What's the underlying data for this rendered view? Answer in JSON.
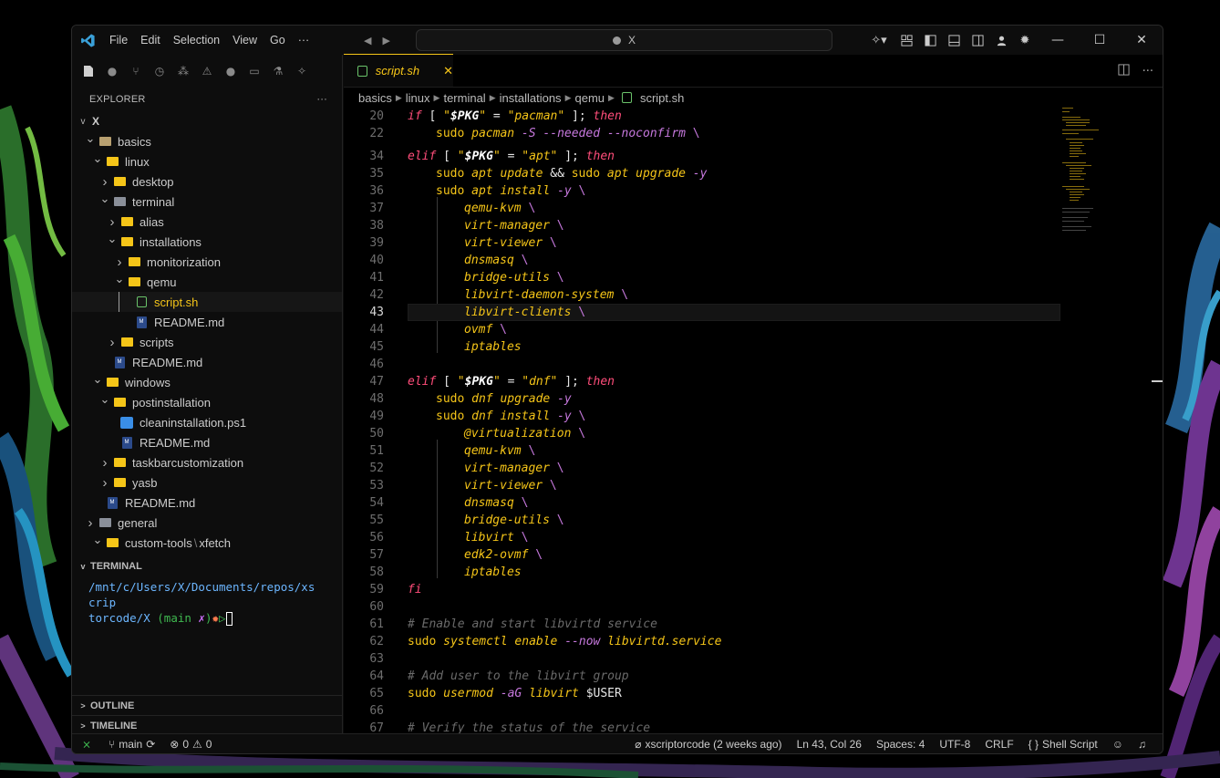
{
  "titlebar": {
    "menu": [
      "File",
      "Edit",
      "Selection",
      "View",
      "Go"
    ],
    "more": "···",
    "command_center": "X"
  },
  "explorer": {
    "header": "EXPLORER",
    "more": "···",
    "root": "X",
    "rows": [
      {
        "indent": 1,
        "chev": "v",
        "icon": "folder-dim",
        "label": "basics"
      },
      {
        "indent": 2,
        "chev": "v",
        "icon": "folder",
        "label": "linux"
      },
      {
        "indent": 3,
        "chev": ">",
        "icon": "folder",
        "label": "desktop"
      },
      {
        "indent": 3,
        "chev": "v",
        "icon": "folder-gray",
        "label": "terminal"
      },
      {
        "indent": 4,
        "chev": ">",
        "icon": "folder",
        "label": "alias"
      },
      {
        "indent": 4,
        "chev": "v",
        "icon": "folder",
        "label": "installations"
      },
      {
        "indent": 5,
        "chev": ">",
        "icon": "folder",
        "label": "monitorization"
      },
      {
        "indent": 5,
        "chev": "v",
        "icon": "folder",
        "label": "qemu"
      },
      {
        "indent": 6,
        "chev": "",
        "icon": "shell",
        "label": "script.sh",
        "active": true
      },
      {
        "indent": 6,
        "chev": "",
        "icon": "md",
        "label": "README.md"
      },
      {
        "indent": 4,
        "chev": ">",
        "icon": "folder",
        "label": "scripts"
      },
      {
        "indent": 4,
        "chev": "",
        "icon": "md",
        "label": "README.md",
        "shift": -1
      },
      {
        "indent": 2,
        "chev": "v",
        "icon": "folder",
        "label": "windows"
      },
      {
        "indent": 3,
        "chev": "v",
        "icon": "folder",
        "label": "postinstallation"
      },
      {
        "indent": 4,
        "chev": "",
        "icon": "ps",
        "label": "cleaninstallation.ps1"
      },
      {
        "indent": 4,
        "chev": "",
        "icon": "md",
        "label": "README.md"
      },
      {
        "indent": 3,
        "chev": ">",
        "icon": "folder",
        "label": "taskbarcustomization"
      },
      {
        "indent": 3,
        "chev": ">",
        "icon": "folder",
        "label": "yasb"
      },
      {
        "indent": 3,
        "chev": "",
        "icon": "md",
        "label": "README.md",
        "shift": -1
      },
      {
        "indent": 1,
        "chev": ">",
        "icon": "folder-gray",
        "label": "general"
      },
      {
        "indent": 2,
        "chev": "v",
        "icon": "folder",
        "label": "custom-tools",
        "suffix": "xfetch"
      }
    ]
  },
  "terminal": {
    "header": "TERMINAL",
    "path_line1": "/mnt/c/Users/X/Documents/repos/xscrip",
    "path_line2": "torcode/X",
    "branch_open": "(main ",
    "branch_mark": "✗",
    "branch_close": ")",
    "glyph1": "✹",
    "glyph2": "▷"
  },
  "panels": {
    "outline": "OUTLINE",
    "timeline": "TIMELINE"
  },
  "editor": {
    "tab_label": "script.sh",
    "tab_close": "✕",
    "breadcrumb": [
      "basics",
      "linux",
      "terminal",
      "installations",
      "qemu"
    ],
    "breadcrumb_file": "script.sh",
    "current_line": "43"
  },
  "code": {
    "l20": {
      "n": "20",
      "k1": "if",
      "b1": " [ ",
      "q1": "\"",
      "v1": "$PKG",
      "q2": "\"",
      "eq": " = ",
      "s1": "\"pacman\"",
      "b2": " ]; ",
      "k2": "then"
    },
    "l22": {
      "n": "22",
      "c1": "sudo",
      "c2": " pacman",
      "f1": " -S",
      "f2": " --needed",
      "f3": " --noconfirm",
      "bs": " \\"
    },
    "l34": {
      "n": "34",
      "k1": "elif",
      "b1": " [ ",
      "q1": "\"",
      "v1": "$PKG",
      "q2": "\"",
      "eq": " = ",
      "s1": "\"apt\"",
      "b2": " ]; ",
      "k2": "then"
    },
    "l35": {
      "n": "35",
      "c1": "sudo",
      "c2": " apt",
      "c3": " update",
      "amp": " && ",
      "c4": "sudo",
      "c5": " apt",
      "c6": " upgrade",
      "f1": " -y"
    },
    "l36": {
      "n": "36",
      "c1": "sudo",
      "c2": " apt",
      "c3": " install",
      "f1": " -y",
      "bs": " \\"
    },
    "apt_pkgs": [
      {
        "n": "37",
        "p": "qemu-kvm"
      },
      {
        "n": "38",
        "p": "virt-manager"
      },
      {
        "n": "39",
        "p": "virt-viewer"
      },
      {
        "n": "40",
        "p": "dnsmasq"
      },
      {
        "n": "41",
        "p": "bridge-utils"
      },
      {
        "n": "42",
        "p": "libvirt-daemon-system"
      },
      {
        "n": "43",
        "p": "libvirt-clients"
      },
      {
        "n": "44",
        "p": "ovmf"
      }
    ],
    "l45": {
      "n": "45",
      "p": "iptables"
    },
    "l46": {
      "n": "46"
    },
    "l47": {
      "n": "47",
      "k1": "elif",
      "b1": " [ ",
      "q1": "\"",
      "v1": "$PKG",
      "q2": "\"",
      "eq": " = ",
      "s1": "\"dnf\"",
      "b2": " ]; ",
      "k2": "then"
    },
    "l48": {
      "n": "48",
      "c1": "sudo",
      "c2": " dnf",
      "c3": " upgrade",
      "f1": " -y"
    },
    "l49": {
      "n": "49",
      "c1": "sudo",
      "c2": " dnf",
      "c3": " install",
      "f1": " -y",
      "bs": " \\"
    },
    "dnf_pkgs": [
      {
        "n": "50",
        "p": "@virtualization"
      },
      {
        "n": "51",
        "p": "qemu-kvm"
      },
      {
        "n": "52",
        "p": "virt-manager"
      },
      {
        "n": "53",
        "p": "virt-viewer"
      },
      {
        "n": "54",
        "p": "dnsmasq"
      },
      {
        "n": "55",
        "p": "bridge-utils"
      },
      {
        "n": "56",
        "p": "libvirt"
      },
      {
        "n": "57",
        "p": "edk2-ovmf"
      }
    ],
    "l58": {
      "n": "58",
      "p": "iptables"
    },
    "l59": {
      "n": "59",
      "k1": "fi"
    },
    "l60": {
      "n": "60"
    },
    "l61": {
      "n": "61",
      "cm": "# Enable and start libvirtd service"
    },
    "l62": {
      "n": "62",
      "c1": "sudo",
      "c2": " systemctl",
      "c3": " enable",
      "f1": " --now",
      "c4": " libvirtd.service"
    },
    "l63": {
      "n": "63"
    },
    "l64": {
      "n": "64",
      "cm": "# Add user to the libvirt group"
    },
    "l65": {
      "n": "65",
      "c1": "sudo",
      "c2": " usermod",
      "f1": " -aG",
      "c3": " libvirt",
      "v1": " $USER"
    },
    "l66": {
      "n": "66"
    },
    "l67": {
      "n": "67",
      "cm": "# Verify the status of the service"
    }
  },
  "statusbar": {
    "branch": "main",
    "errors": "0",
    "warnings": "0",
    "blame": "xscriptorcode (2 weeks ago)",
    "position": "Ln 43, Col 26",
    "spaces": "Spaces: 4",
    "encoding": "UTF-8",
    "eol": "CRLF",
    "language": "Shell Script"
  },
  "colors": {
    "accent": "#f5c518",
    "keyword": "#ff4d7a",
    "flag": "#c678dd",
    "terminal_path": "#6cb6ff",
    "git": "#3fb950"
  }
}
